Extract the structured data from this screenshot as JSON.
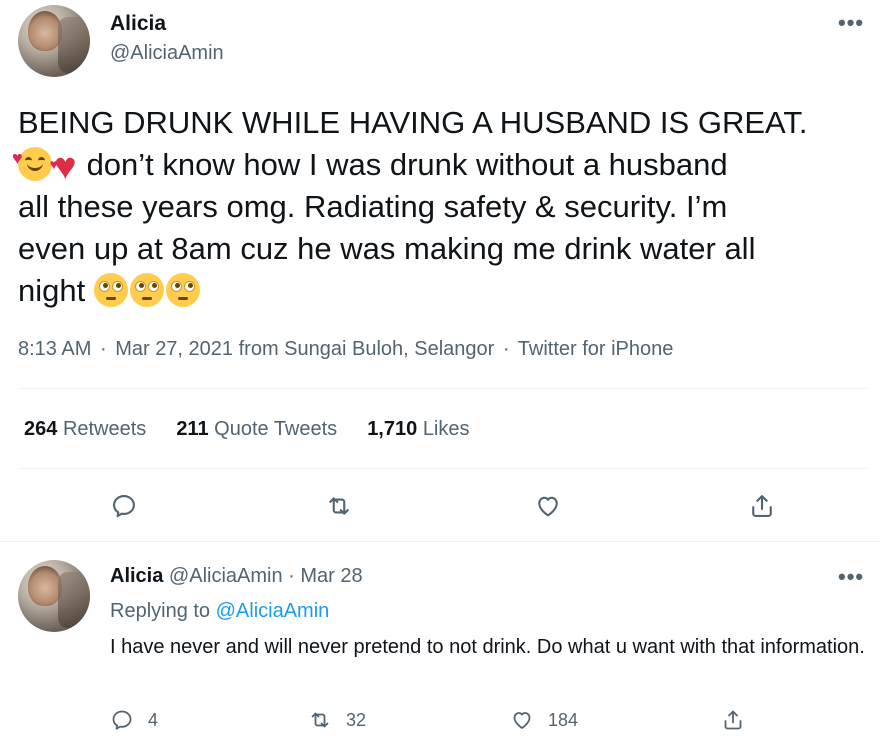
{
  "tweet": {
    "author_name": "Alicia",
    "author_handle": "@AliciaAmin",
    "text_line1": "BEING DRUNK WHILE HAVING A HUSBAND IS GREAT.",
    "text_line2": "don’t know how I was drunk without a husband",
    "text_line3": "all these years omg. Radiating safety & security. I’m",
    "text_line4": "even up at 8am cuz he was making me drink water all",
    "text_line5": "night",
    "time": "8:13 AM",
    "date": "Mar 27, 2021",
    "location_prefix": "from",
    "location": "Sungai Buloh, Selangor",
    "source": "Twitter for iPhone",
    "sep": "·",
    "emoji": [
      "smiling-face-with-hearts",
      "red-heart",
      "face-with-rolling-eyes",
      "face-with-rolling-eyes",
      "face-with-rolling-eyes"
    ]
  },
  "stats": {
    "retweets_count": "264",
    "retweets_label": "Retweets",
    "quotes_count": "211",
    "quotes_label": "Quote Tweets",
    "likes_count": "1,710",
    "likes_label": "Likes"
  },
  "reply": {
    "author_name": "Alicia",
    "author_handle": "@AliciaAmin",
    "sep": "·",
    "date": "Mar 28",
    "replying_prefix": "Replying to",
    "replying_to": "@AliciaAmin",
    "text": "I have never and will never pretend to not drink. Do what u want with that information.",
    "reply_count": "4",
    "retweet_count": "32",
    "like_count": "184"
  },
  "colors": {
    "text": "#0f1419",
    "secondary": "#536471",
    "link": "#1d9bf0",
    "divider": "#eff3f4"
  },
  "icons": {
    "more": "more-horizontal-icon",
    "reply": "reply-icon",
    "retweet": "retweet-icon",
    "like": "heart-icon",
    "share": "share-icon"
  }
}
